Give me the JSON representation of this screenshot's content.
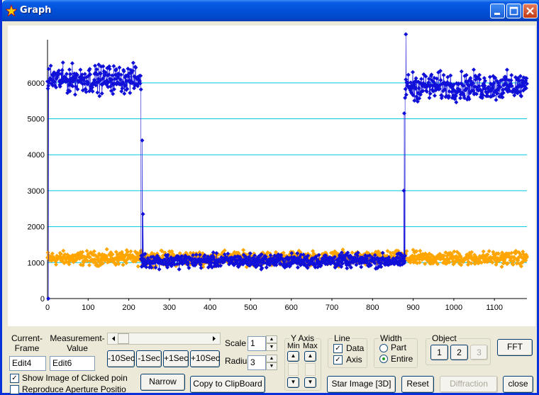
{
  "window": {
    "title": "Graph"
  },
  "colors": {
    "series_a": "#1010d8",
    "series_b": "#ffa500",
    "grid": "#00c8d8",
    "title_bar": "#0250d8"
  },
  "chart_data": {
    "type": "scatter",
    "title": "",
    "xlabel": "",
    "ylabel": "",
    "xlim": [
      0,
      1180
    ],
    "ylim": [
      0,
      7200
    ],
    "x_ticks": [
      0,
      100,
      200,
      300,
      400,
      500,
      600,
      700,
      800,
      900,
      1000,
      1100
    ],
    "y_ticks": [
      0,
      1000,
      2000,
      3000,
      4000,
      5000,
      6000
    ],
    "grid": "horizontal",
    "series": [
      {
        "color": "#1010d8",
        "style": "line-with-markers",
        "segments": [
          {
            "x_start": 0,
            "x_end": 230,
            "level": 6100,
            "noise": 550
          },
          {
            "x_start": 230,
            "x_end": 880,
            "level": 1050,
            "noise": 280
          },
          {
            "x_start": 880,
            "x_end": 1180,
            "level": 5900,
            "noise": 550
          }
        ],
        "transitions": [
          {
            "x": 233,
            "y": 4400
          },
          {
            "x": 235,
            "y": 2350
          },
          {
            "x": 877,
            "y": 3000
          },
          {
            "x": 878,
            "y": 5150
          },
          {
            "x": 882,
            "y": 7350
          },
          {
            "x": 2,
            "y": 0
          }
        ]
      },
      {
        "color": "#ffa500",
        "style": "markers",
        "segments": [
          {
            "x_start": 0,
            "x_end": 1180,
            "level": 1120,
            "noise": 280
          }
        ]
      }
    ]
  },
  "controls": {
    "current_frame_label": "Current-\nFrame",
    "current_frame_value": "Edit4",
    "measurement_value_label": "Measurement-\nValue",
    "measurement_value_value": "Edit6",
    "btn_m10": "-10Sec",
    "btn_m1": "-1Sec",
    "btn_p1": "+1Sec",
    "btn_p10": "+10Sec",
    "scale_label": "Scale",
    "scale_value": "1",
    "radius_label": "Radius",
    "radius_value": "3",
    "y_axis_title": "Y Axis",
    "y_min_label": "Min",
    "y_max_label": "Max",
    "line_title": "Line",
    "line_data": "Data",
    "line_axis": "Axis",
    "width_title": "Width",
    "width_part": "Part",
    "width_entire": "Entire",
    "object_title": "Object",
    "object_1": "1",
    "object_2": "2",
    "object_3": "3",
    "fft": "FFT",
    "show_image": "Show Image of Clicked poin",
    "reproduce": "Reproduce Aperture Positio",
    "narrow": "Narrow",
    "copy": "Copy to ClipBoard",
    "star_image": "Star Image [3D]",
    "reset": "Reset",
    "diffraction": "Diffraction",
    "close": "close"
  }
}
